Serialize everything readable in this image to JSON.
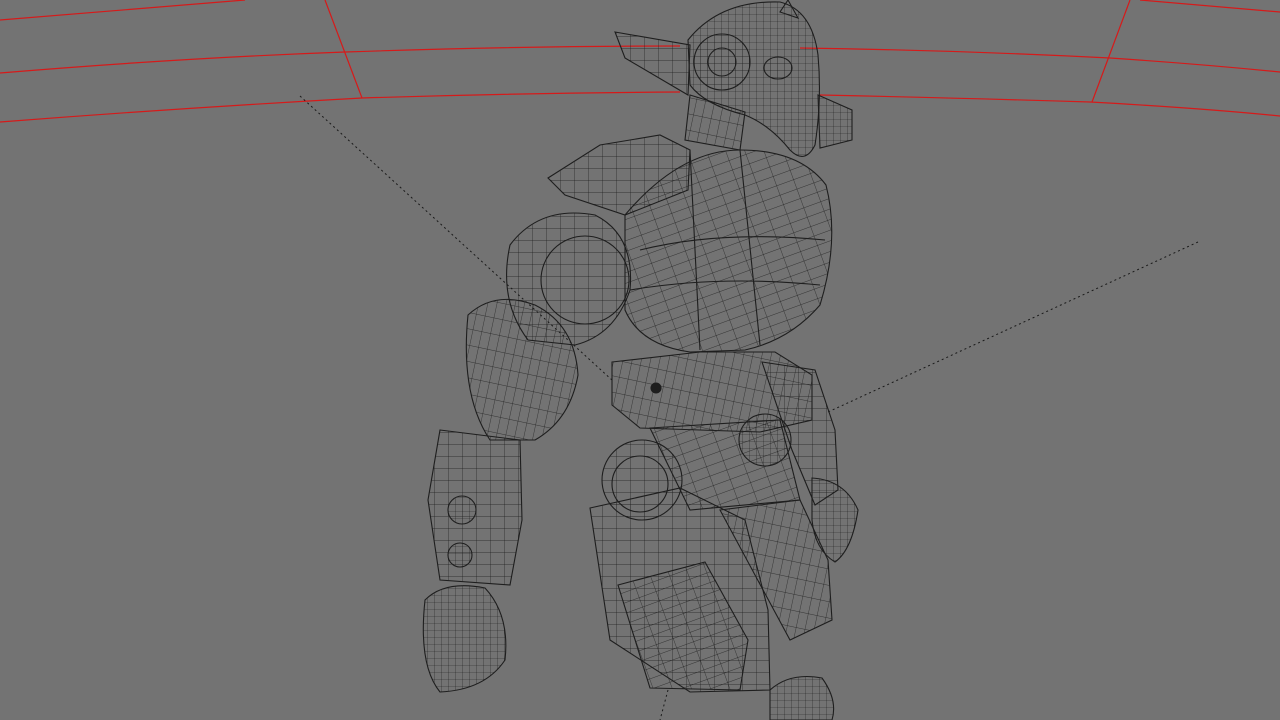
{
  "viewport": {
    "background": "#737373",
    "wire_color": "#1e1e1e",
    "guide_color": "#d61a1a",
    "light_dotted_color": "#1a1a1a",
    "subject_icon": "robot-mech-wireframe"
  }
}
